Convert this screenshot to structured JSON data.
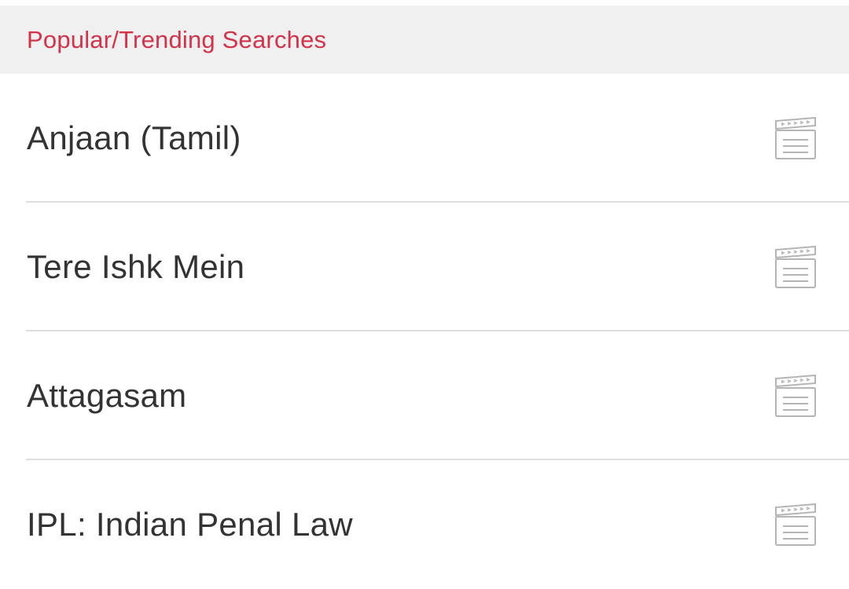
{
  "section": {
    "title": "Popular/Trending Searches"
  },
  "items": [
    {
      "label": "Anjaan (Tamil)",
      "icon": "movie-clapperboard-icon"
    },
    {
      "label": "Tere Ishk Mein",
      "icon": "movie-clapperboard-icon"
    },
    {
      "label": "Attagasam",
      "icon": "movie-clapperboard-icon"
    },
    {
      "label": "IPL: Indian Penal Law",
      "icon": "movie-clapperboard-icon"
    }
  ],
  "colors": {
    "accent": "#d2334a",
    "header_bg": "#f0f0f0",
    "text": "#333333",
    "divider": "#dedede",
    "icon": "#b5b5b5"
  }
}
